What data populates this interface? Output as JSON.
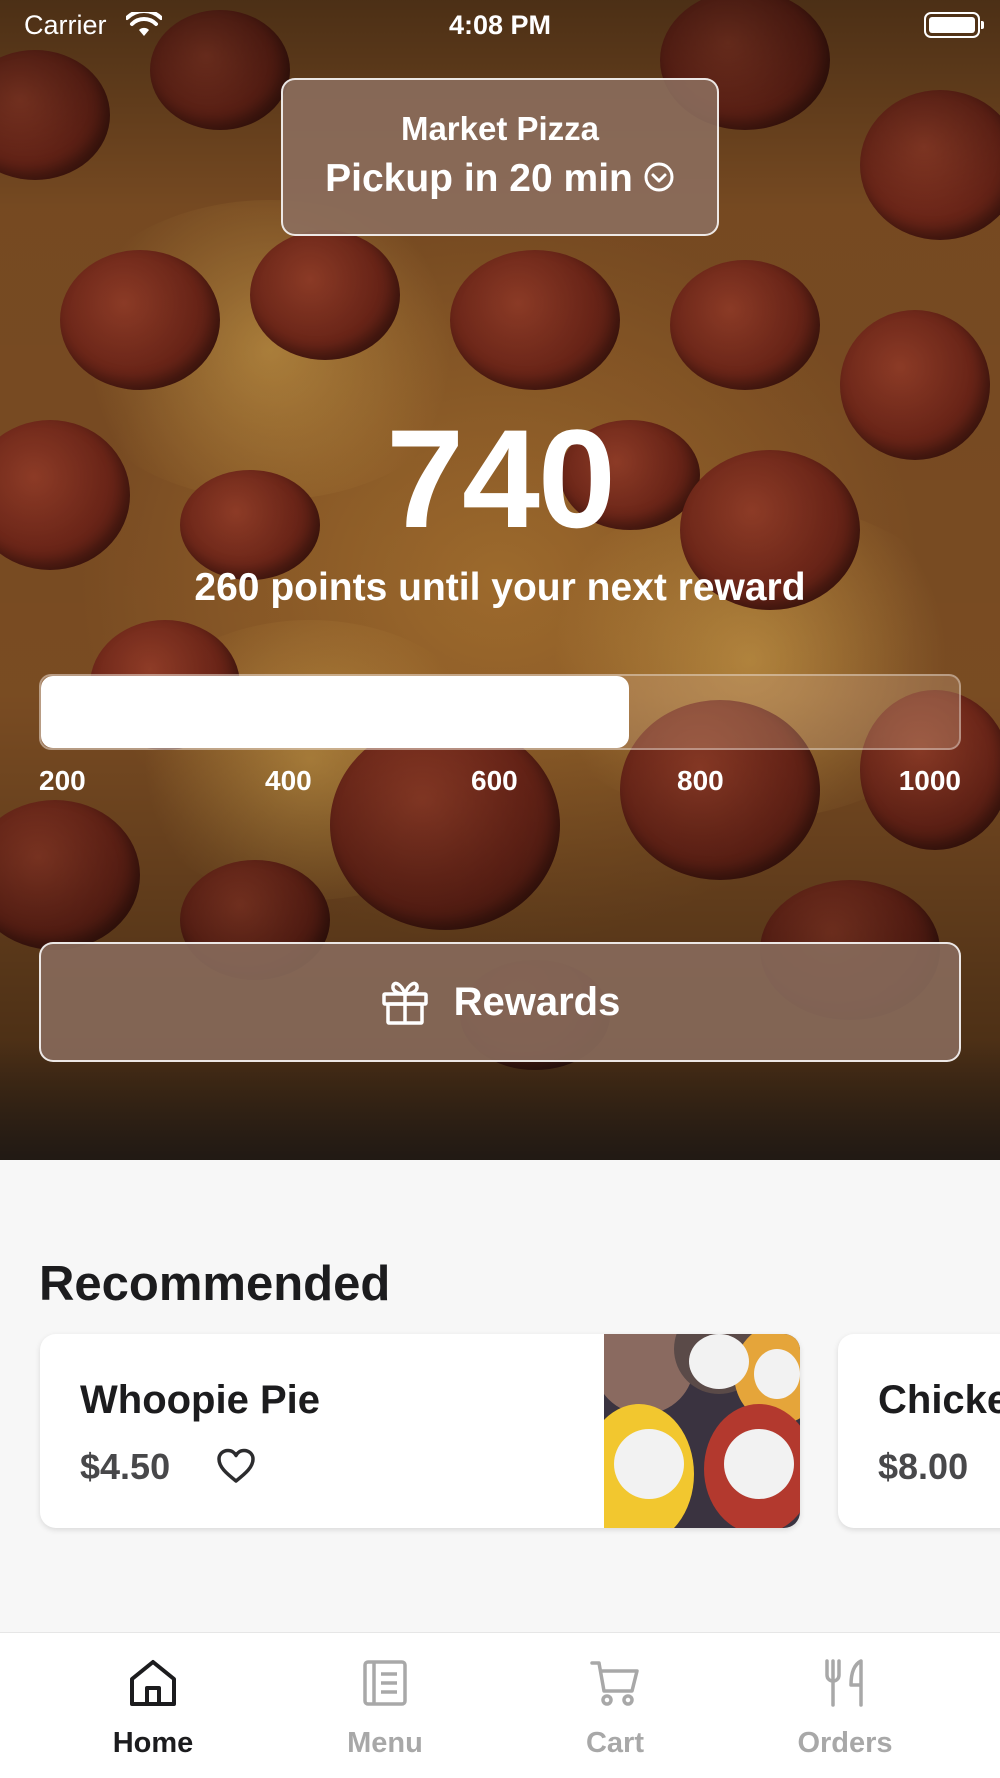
{
  "status_bar": {
    "carrier": "Carrier",
    "time": "4:08 PM"
  },
  "store": {
    "name": "Market Pizza",
    "pickup": "Pickup in 20 min"
  },
  "points": {
    "value": "740",
    "until_text": "260 points until your next reward",
    "progress_fraction": 0.64,
    "ticks": [
      "200",
      "400",
      "600",
      "800",
      "1000"
    ]
  },
  "rewards_button": {
    "label": "Rewards",
    "icon": "gift-icon"
  },
  "recommended": {
    "title": "Recommended",
    "items": [
      {
        "name": "Whoopie Pie",
        "price": "$4.50"
      },
      {
        "name": "Chicke",
        "price": "$8.00"
      }
    ]
  },
  "tab_bar": {
    "items": [
      {
        "label": "Home",
        "icon": "home-icon",
        "active": true
      },
      {
        "label": "Menu",
        "icon": "menu-icon",
        "active": false
      },
      {
        "label": "Cart",
        "icon": "cart-icon",
        "active": false
      },
      {
        "label": "Orders",
        "icon": "orders-icon",
        "active": false
      }
    ]
  },
  "colors": {
    "hero_button_bg": "#87695a",
    "active_tab": "#1c1c1e",
    "inactive_tab": "#a8a8a8",
    "page_bg": "#f7f7f7"
  }
}
